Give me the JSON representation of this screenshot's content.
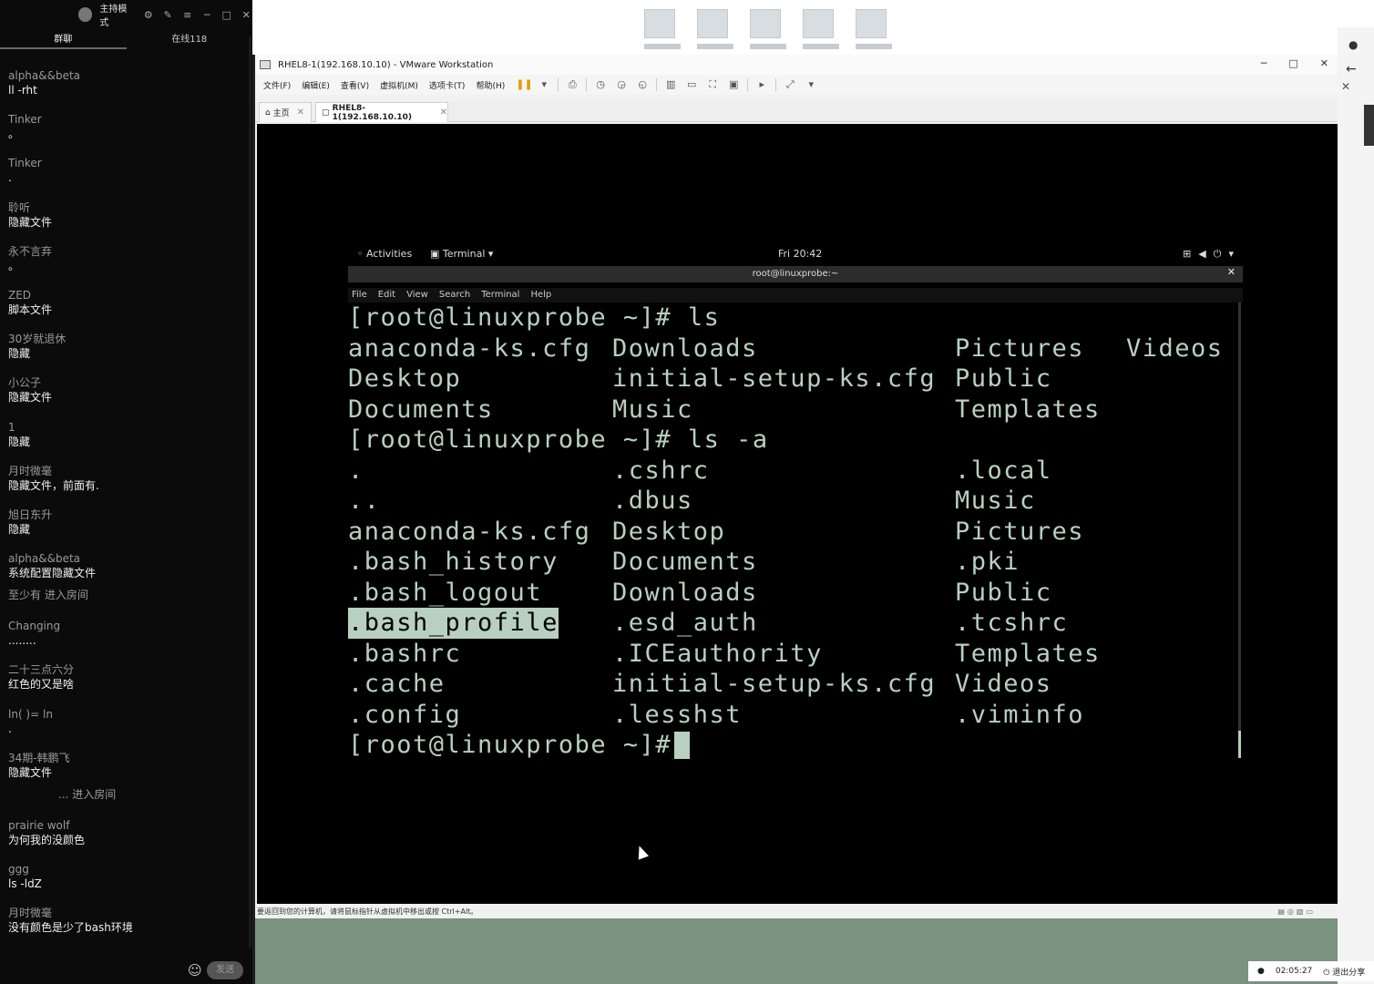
{
  "chat": {
    "mode_label": "主持模式",
    "tabs": [
      {
        "label": "群聊"
      },
      {
        "label": "在线118"
      }
    ],
    "messages": [
      {
        "user": "alpha&&beta",
        "text": "ll -rht"
      },
      {
        "user": "Tinker",
        "text": "。"
      },
      {
        "user": "Tinker",
        "text": "."
      },
      {
        "user": "聆听",
        "text": "隐藏文件"
      },
      {
        "user": "永不言弃",
        "text": "。"
      },
      {
        "user": "ZED",
        "text": "脚本文件"
      },
      {
        "user": "30岁就退休",
        "text": "隐藏"
      },
      {
        "user": "小公子",
        "text": "隐藏文件"
      },
      {
        "user": "1",
        "text": "隐藏"
      },
      {
        "user": "月时微毫",
        "text": "隐藏文件，前面有."
      },
      {
        "user": "旭日东升",
        "text": "隐藏"
      },
      {
        "user": "alpha&&beta",
        "text": "系统配置隐藏文件"
      },
      {
        "system": true,
        "text": "至少有 进入房间"
      },
      {
        "user": "Changing",
        "text": "........"
      },
      {
        "user": "二十三点六分",
        "text": "红色的又是啥"
      },
      {
        "user": "ln(   )=    ln",
        "text": "."
      },
      {
        "user": "34期-韩鹏飞",
        "text": "隐藏文件"
      },
      {
        "system": true,
        "center": true,
        "text": "... 进入房间"
      },
      {
        "user": "prairie wolf",
        "text": "为何我的没颜色"
      },
      {
        "user": "ggg",
        "text": "ls -ldZ"
      },
      {
        "user": "月时微毫",
        "text": "没有颜色是少了bash环境"
      }
    ],
    "send_label": "发送"
  },
  "vmware": {
    "title": "RHEL8-1(192.168.10.10) - VMware Workstation",
    "menu": [
      "文件(F)",
      "编辑(E)",
      "查看(V)",
      "虚拟机(M)",
      "选项卡(T)",
      "帮助(H)"
    ],
    "tabs": [
      {
        "label": "主页"
      },
      {
        "label": "RHEL8-1(192.168.10.10)"
      }
    ],
    "status_text": "要返回到您的计算机，请将鼠标指针从虚拟机中移出或按 Ctrl+Alt。"
  },
  "gnome": {
    "activities": "Activities",
    "app_menu": "Terminal",
    "clock": "Fri 20:42"
  },
  "terminal": {
    "title": "root@linuxprobe:~",
    "menu": [
      "File",
      "Edit",
      "View",
      "Search",
      "Terminal",
      "Help"
    ],
    "lines": [
      {
        "cols": [
          "[root@linuxprobe ~]# ls"
        ]
      },
      {
        "cols": [
          "anaconda-ks.cfg",
          "Downloads",
          "Pictures",
          "Videos"
        ]
      },
      {
        "cols": [
          "Desktop",
          "initial-setup-ks.cfg",
          "Public"
        ]
      },
      {
        "cols": [
          "Documents",
          "Music",
          "Templates"
        ]
      },
      {
        "cols": [
          "[root@linuxprobe ~]# ls -a"
        ]
      },
      {
        "cols": [
          ".",
          ".cshrc",
          ".local"
        ]
      },
      {
        "cols": [
          "..",
          ".dbus",
          "Music"
        ]
      },
      {
        "cols": [
          "anaconda-ks.cfg",
          "Desktop",
          "Pictures"
        ]
      },
      {
        "cols": [
          ".bash_history",
          "Documents",
          ".pki"
        ]
      },
      {
        "cols": [
          ".bash_logout",
          "Downloads",
          "Public"
        ]
      },
      {
        "cols": [
          ".bash_profile",
          ".esd_auth",
          ".tcshrc"
        ]
      },
      {
        "cols": [
          ".bashrc",
          ".ICEauthority",
          "Templates"
        ]
      },
      {
        "cols": [
          ".cache",
          "initial-setup-ks.cfg",
          "Videos"
        ]
      },
      {
        "cols": [
          ".config",
          ".lesshst",
          ".viminfo"
        ]
      },
      {
        "cols": [
          "[root@linuxprobe ~]# "
        ]
      }
    ],
    "selected_text": ".bash_profile",
    "text_color": "#b8d0c0"
  },
  "timer": {
    "elapsed": "02:05:27",
    "exit_share": "退出分享"
  }
}
